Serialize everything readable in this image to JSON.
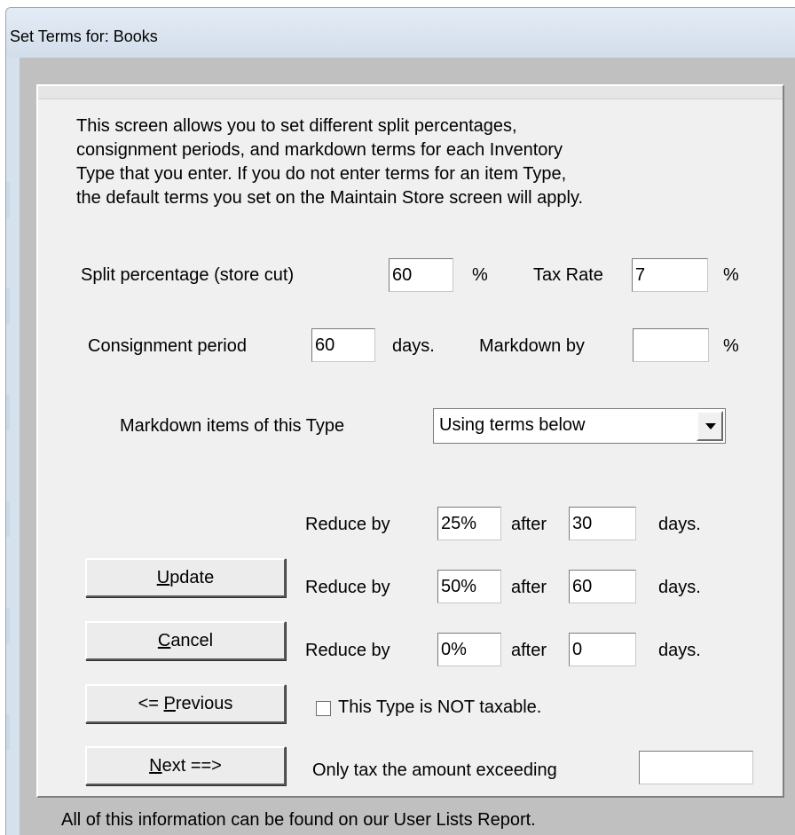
{
  "window": {
    "title": "Set Terms for:  Books"
  },
  "intro_lines": [
    "This screen allows you to set different split percentages,",
    "consignment periods, and markdown terms for each Inventory",
    "Type that you enter.  If you do not enter terms for an item Type,",
    "the default terms you set on the Maintain Store screen will apply."
  ],
  "split": {
    "label": "Split percentage (store cut)",
    "value": "60",
    "unit": "%"
  },
  "tax": {
    "label": "Tax Rate",
    "value": "7",
    "unit": "%"
  },
  "consignment": {
    "label": "Consignment period",
    "value": "60",
    "unit": "days."
  },
  "markdown": {
    "label": "Markdown by",
    "value": "",
    "unit": "%"
  },
  "markdown_items": {
    "label": "Markdown items of this Type",
    "selected": "Using terms below"
  },
  "reduce_rows": [
    {
      "label": "Reduce by",
      "percent": "25%",
      "after_label": "after",
      "days": "30",
      "days_label": "days."
    },
    {
      "label": "Reduce by",
      "percent": "50%",
      "after_label": "after",
      "days": "60",
      "days_label": "days."
    },
    {
      "label": "Reduce by",
      "percent": "0%",
      "after_label": "after",
      "days": "0",
      "days_label": "days."
    }
  ],
  "buttons": {
    "update": {
      "mnemonic": "U",
      "rest": "pdate"
    },
    "cancel": {
      "mnemonic": "C",
      "rest": "ancel"
    },
    "previous": {
      "prefix": "<= ",
      "mnemonic": "P",
      "rest": "revious"
    },
    "next": {
      "mnemonic": "N",
      "rest": "ext ==>"
    }
  },
  "not_taxable": {
    "label": "This Type is NOT taxable.",
    "checked": false
  },
  "tax_exceeding": {
    "label": "Only tax the amount exceeding",
    "value": ""
  },
  "footer": "All of this information can be found on our User Lists Report."
}
